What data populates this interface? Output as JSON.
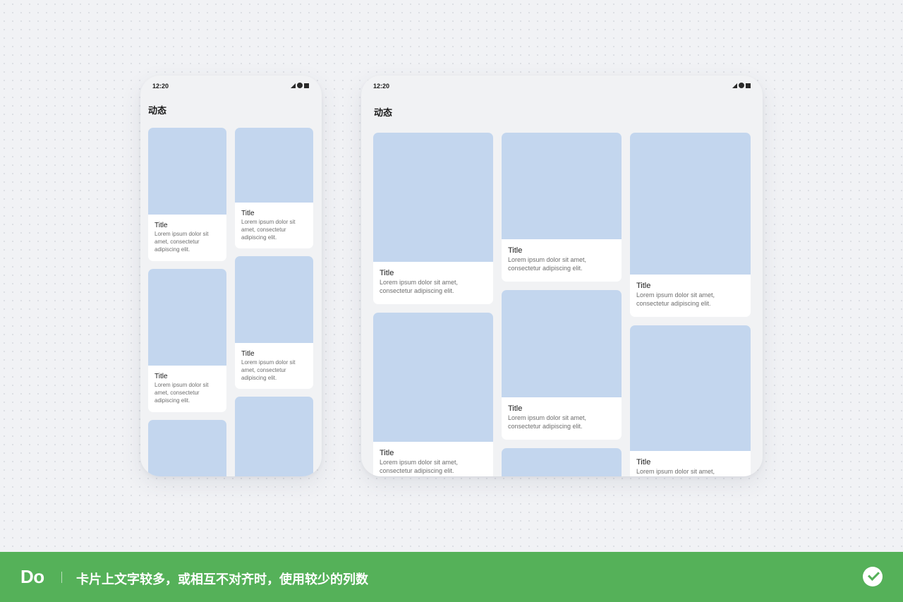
{
  "phone": {
    "status_time": "12:20",
    "title": "动态",
    "columns": [
      [
        {
          "title": "Title",
          "desc": "Lorem ipsum dolor sit amet, consectetur adipiscing elit."
        },
        {
          "title": "Title",
          "desc": "Lorem ipsum dolor sit amet, consectetur adipiscing elit."
        },
        {
          "title": "",
          "desc": ""
        }
      ],
      [
        {
          "title": "Title",
          "desc": "Lorem ipsum dolor sit amet, consectetur adipiscing elit."
        },
        {
          "title": "Title",
          "desc": "Lorem ipsum dolor sit amet, consectetur adipiscing elit."
        },
        {
          "title": "",
          "desc": ""
        }
      ]
    ]
  },
  "tablet": {
    "status_time": "12:20",
    "title": "动态",
    "columns": [
      [
        {
          "title": "Title",
          "desc": "Lorem ipsum dolor sit amet, consectetur adipiscing elit."
        },
        {
          "title": "Title",
          "desc": "Lorem ipsum dolor sit amet, consectetur adipiscing elit."
        }
      ],
      [
        {
          "title": "Title",
          "desc": "Lorem ipsum dolor sit amet, consectetur adipiscing elit."
        },
        {
          "title": "Title",
          "desc": "Lorem ipsum dolor sit amet, consectetur adipiscing elit."
        },
        {
          "title": "",
          "desc": ""
        }
      ],
      [
        {
          "title": "Title",
          "desc": "Lorem ipsum dolor sit amet, consectetur adipiscing elit."
        },
        {
          "title": "Title",
          "desc": "Lorem ipsum dolor sit amet,"
        }
      ]
    ]
  },
  "bottom_bar": {
    "label": "Do",
    "text": "卡片上文字较多，或相互不对齐时，使用较少的列数"
  },
  "colors": {
    "placeholder_image": "#c3d6ee",
    "bar_green": "#55b159"
  }
}
